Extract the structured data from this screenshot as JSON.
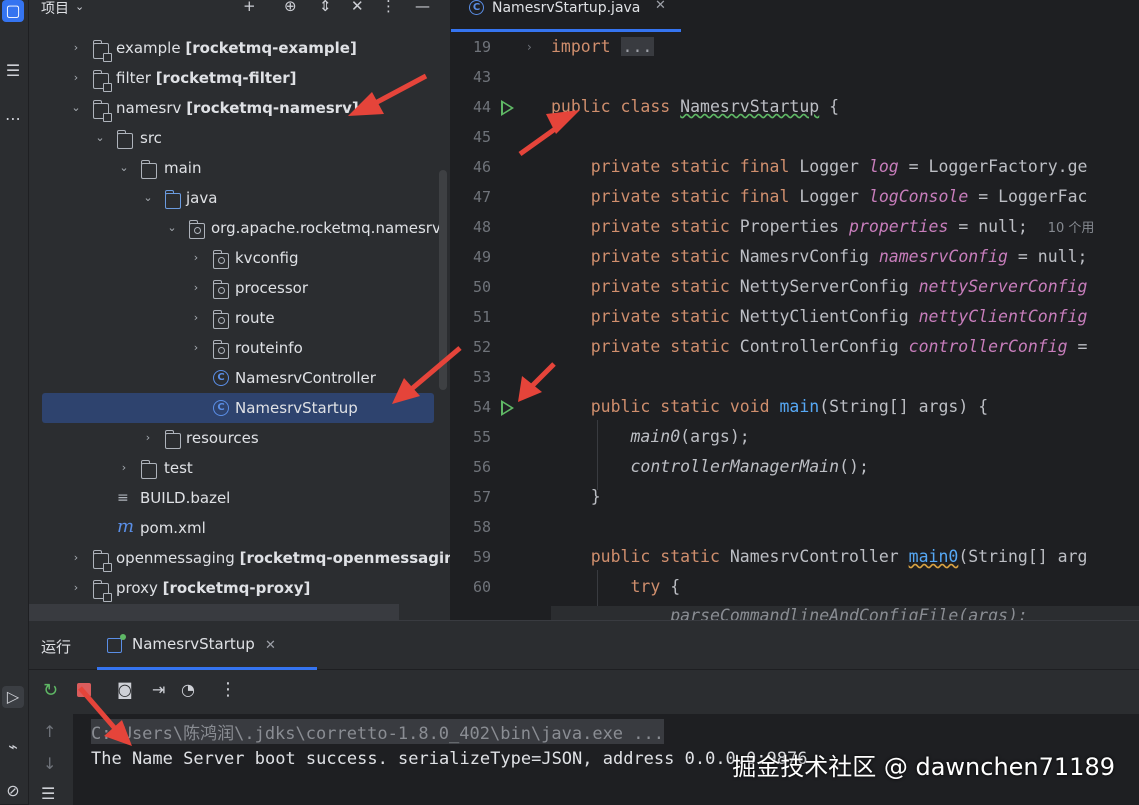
{
  "project_panel": {
    "title": "项目",
    "tree": [
      {
        "name": "example",
        "module": "[rocketmq-example]"
      },
      {
        "name": "filter",
        "module": "[rocketmq-filter]"
      },
      {
        "name": "namesrv",
        "module": "[rocketmq-namesrv]"
      },
      {
        "name": "src"
      },
      {
        "name": "main"
      },
      {
        "name": "java"
      },
      {
        "name": "org.apache.rocketmq.namesrv"
      },
      {
        "name": "kvconfig"
      },
      {
        "name": "processor"
      },
      {
        "name": "route"
      },
      {
        "name": "routeinfo"
      },
      {
        "name": "NamesrvController"
      },
      {
        "name": "NamesrvStartup"
      },
      {
        "name": "resources"
      },
      {
        "name": "test"
      },
      {
        "name": "BUILD.bazel"
      },
      {
        "name": "pom.xml"
      },
      {
        "name": "openmessaging",
        "module": "[rocketmq-openmessaging]"
      },
      {
        "name": "proxy",
        "module": "[rocketmq-proxy]"
      }
    ]
  },
  "editor": {
    "tab_label": "NamesrvStartup.java",
    "line_numbers": [
      "19",
      "43",
      "44",
      "45",
      "46",
      "47",
      "48",
      "49",
      "50",
      "51",
      "52",
      "53",
      "54",
      "55",
      "56",
      "57",
      "58",
      "59",
      "60"
    ],
    "code": {
      "import_kw": "import",
      "import_fold": "...",
      "l44_kw": "public class",
      "l44_name": "NamesrvStartup",
      "l44_rest": " {",
      "pss": "private static",
      "psf": "private static final",
      "logger": " Logger ",
      "log": "log",
      "log_rest": " = LoggerFactory.ge",
      "logConsole": "logConsole",
      "logConsole_rest": " = LoggerFac",
      "properties_type": " Properties ",
      "properties": "properties",
      "properties_rest": " = null;",
      "properties_hint": "10 个用",
      "nsc_type": " NamesrvConfig ",
      "nsc": "namesrvConfig",
      "nsc_rest": " = null;",
      "nettyserver_type": " NettyServerConfig ",
      "nettyserver": "nettyServerConfig",
      "nettyclient_type": " NettyClientConfig ",
      "nettyclient": "nettyClientConfig",
      "controller_type": " ControllerConfig ",
      "controller": "controllerConfig",
      "controller_rest": " =",
      "main_kw": "public static void",
      "main_name": "main",
      "main_rest": "(String[] args) {",
      "main0_call": "main0",
      "main0_call_rest": "(args);",
      "cmm_call": "controllerManagerMain",
      "cmm_rest": "();",
      "close_brace": "}",
      "main0_kw": "public static",
      "main0_type": " NamesrvController ",
      "main0_name": "main0",
      "main0_rest": "(String[] arg",
      "try_kw": "try",
      "try_rest": " {",
      "parse_line": "parseCommandlineAndConfigFile(args);"
    }
  },
  "run_panel": {
    "label": "运行",
    "tab_label": "NamesrvStartup",
    "console_lines": [
      "C:\\Users\\陈鸿润\\.jdks\\corretto-1.8.0_402\\bin\\java.exe ...",
      "The Name Server boot success. serializeType=JSON, address 0.0.0.0:9876"
    ]
  },
  "watermark": "掘金技术社区 @ dawnchen71189",
  "colors": {
    "accent": "#3574f0",
    "annotation_arrow": "#e5443a",
    "keyword": "#cf8e6d",
    "field": "#c77dbb",
    "function": "#56a8f5"
  }
}
